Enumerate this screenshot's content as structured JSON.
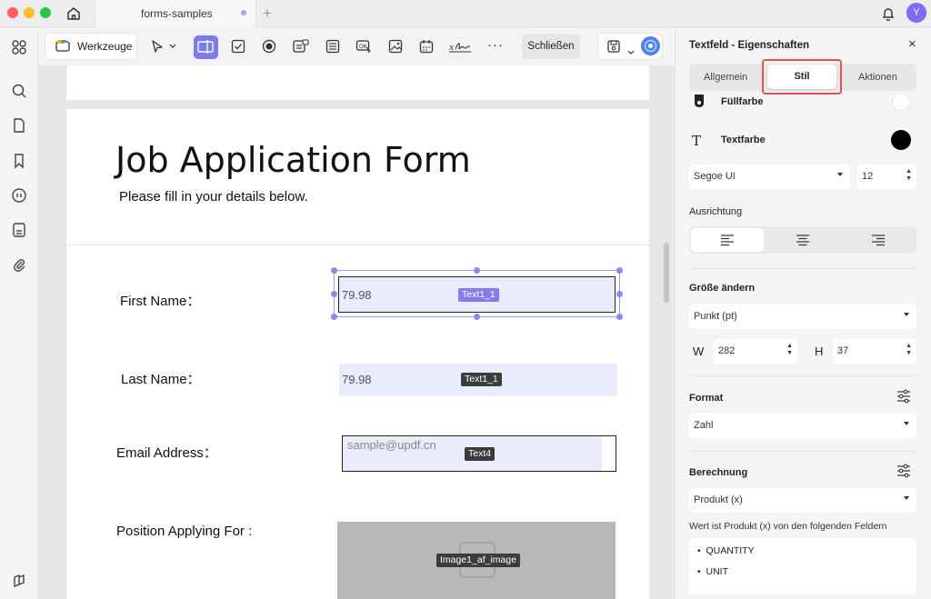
{
  "window": {
    "tab_title": "forms-samples",
    "avatar_letter": "Y"
  },
  "toolbar": {
    "tools_label": "Werkzeuge",
    "close_label": "Schließen"
  },
  "document": {
    "title": "Job Application Form",
    "subtitle": "Please fill in your details below.",
    "fields": [
      {
        "label": "First Name：",
        "value": "79.98",
        "tag": "Text1_1"
      },
      {
        "label": "Last Name：",
        "value": "79.98",
        "tag": "Text1_1"
      },
      {
        "label": "Email Address：",
        "value": "sample@updf.cn",
        "tag": "Text4"
      },
      {
        "label": "Position Applying For :",
        "tag": "Image1_af_image"
      }
    ]
  },
  "panel": {
    "title": "Textfeld - Eigenschaften",
    "tabs": [
      "Allgemein",
      "Stil",
      "Aktionen"
    ],
    "active_tab": "Stil",
    "fill_color_label": "Füllfarbe",
    "fill_color": "#ffffff",
    "text_color_label": "Textfarbe",
    "text_color": "#000000",
    "font": "Segoe UI",
    "font_size": "12",
    "alignment_label": "Ausrichtung",
    "resize_label": "Größe ändern",
    "unit": "Punkt (pt)",
    "w_label": "W",
    "w_value": "282",
    "h_label": "H",
    "h_value": "37",
    "format_label": "Format",
    "format_value": "Zahl",
    "calc_label": "Berechnung",
    "calc_value": "Produkt (x)",
    "calc_desc": "Wert ist Produkt (x) von den folgenden Feldern",
    "calc_fields": [
      "QUANTITY",
      "UNIT"
    ]
  },
  "colors": {
    "accent": "#7b7bf0",
    "highlight_border": "#e8504f"
  }
}
